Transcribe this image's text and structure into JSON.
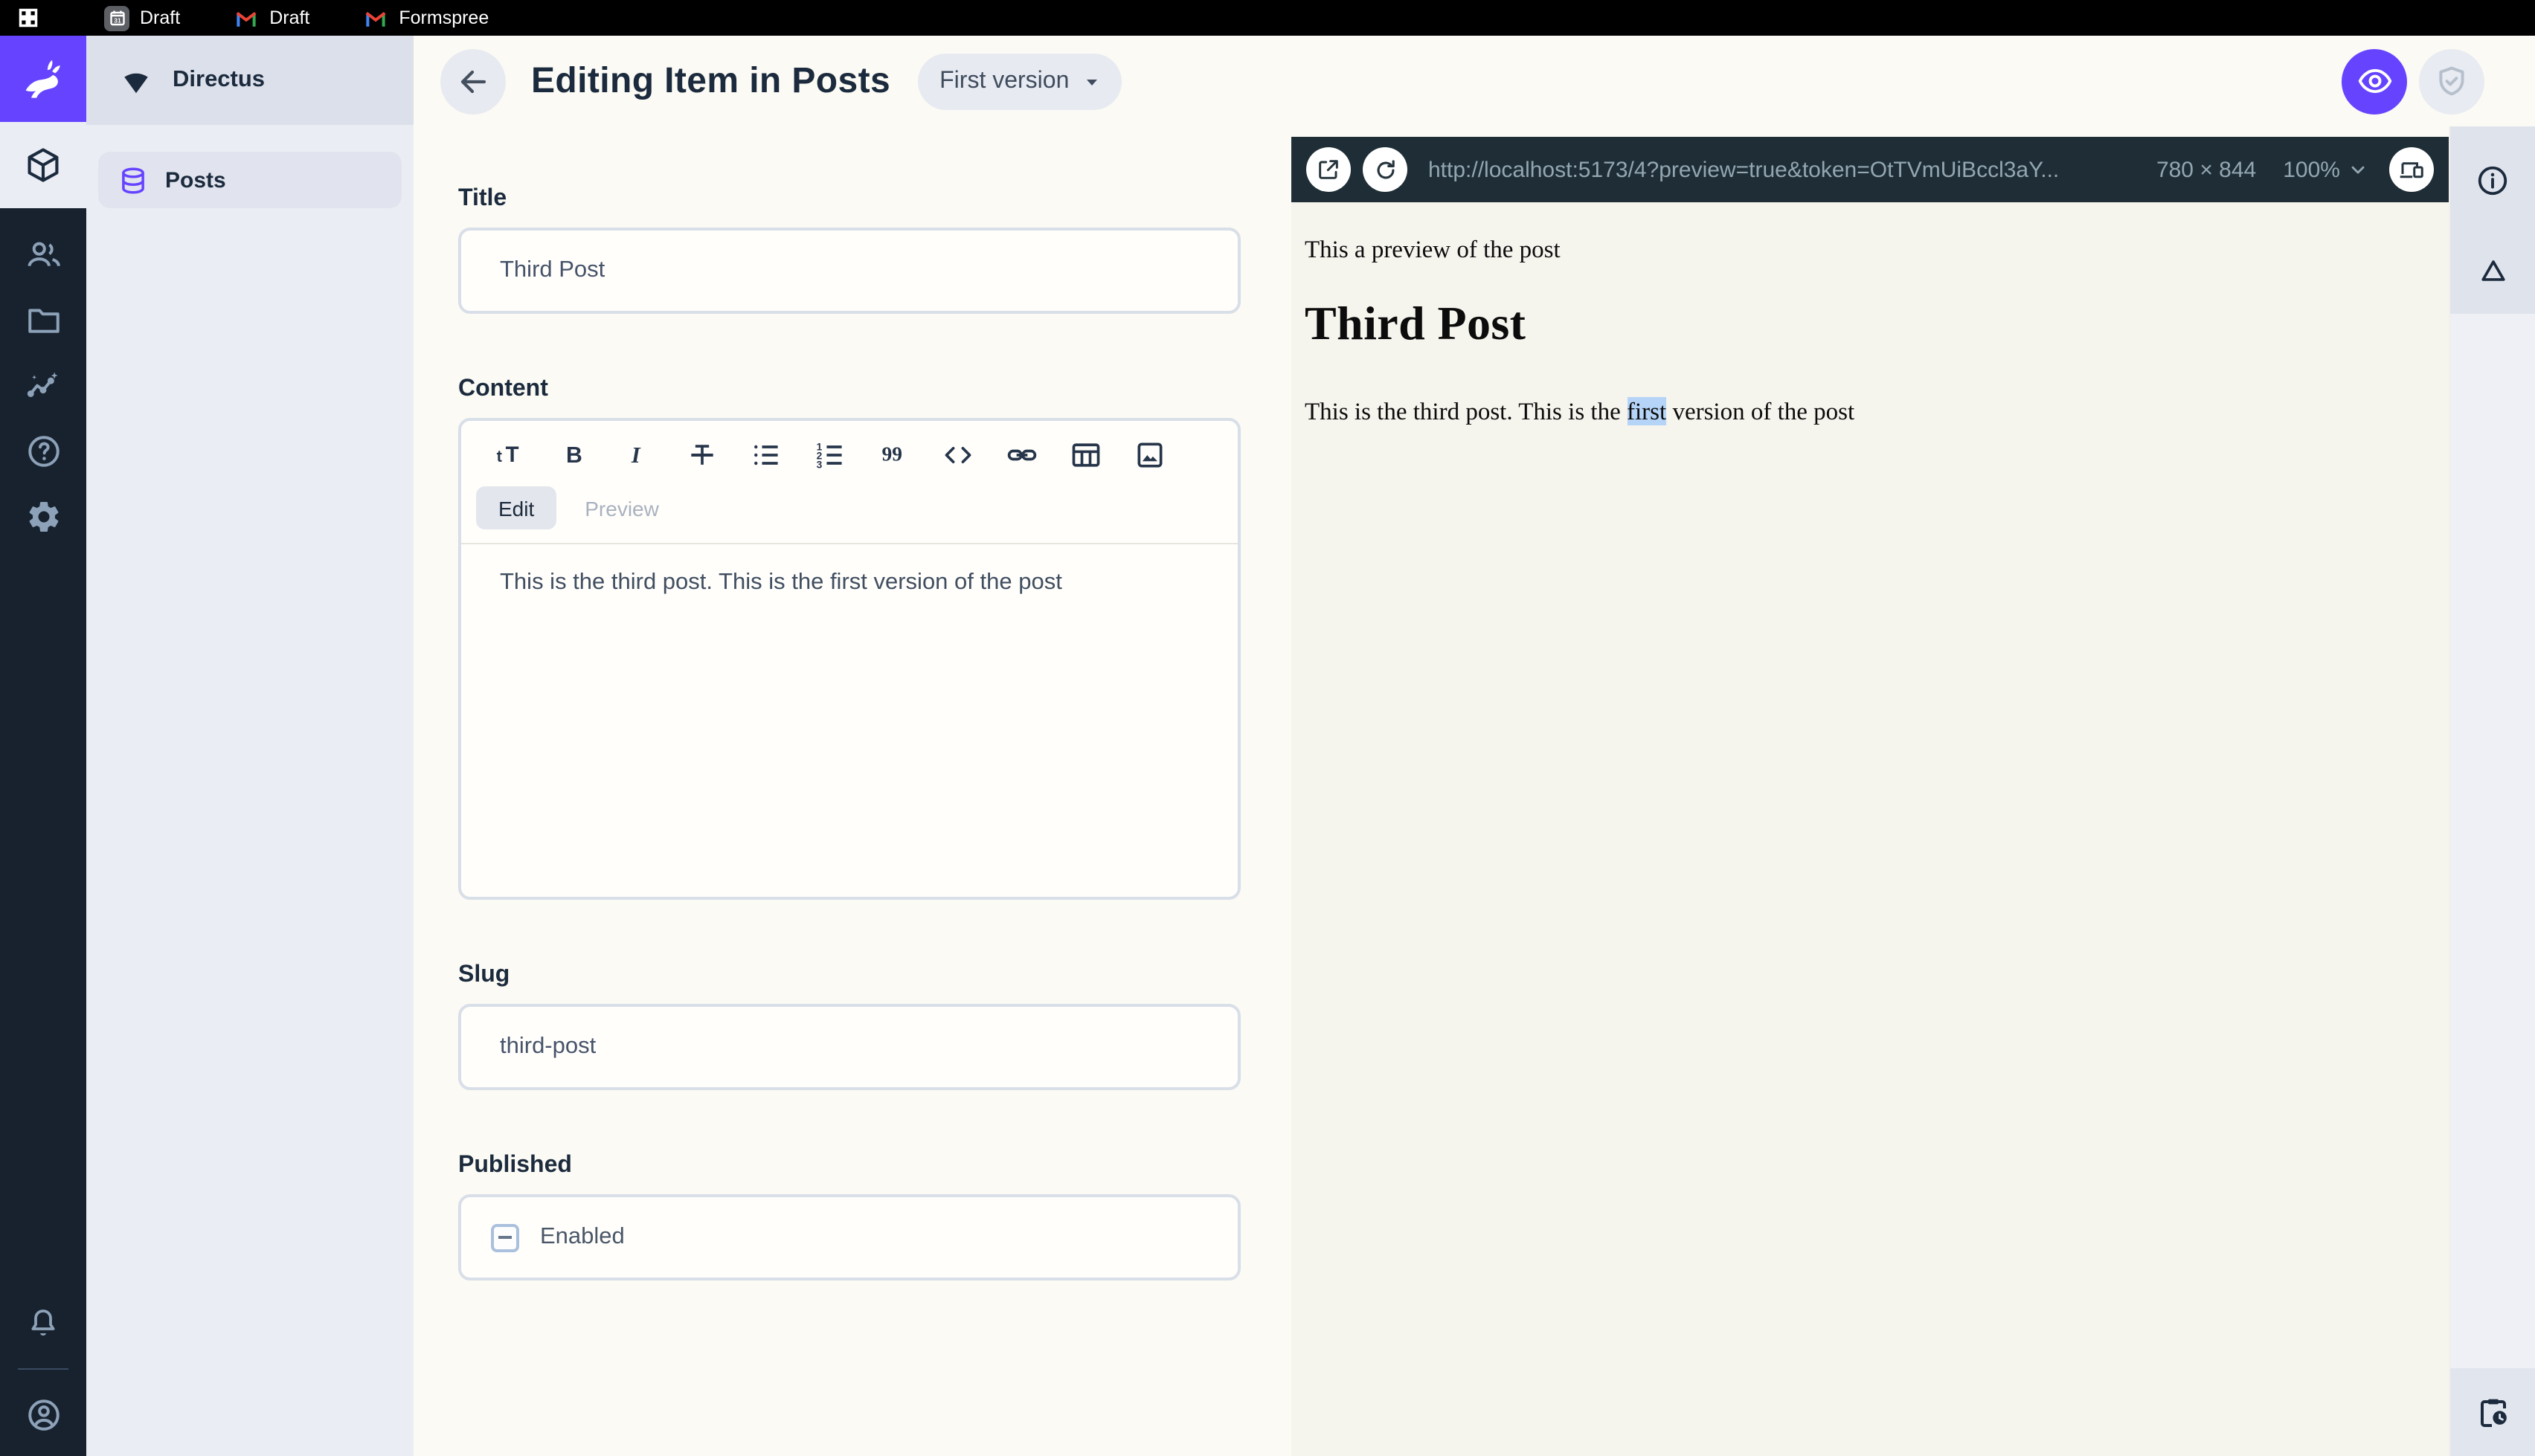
{
  "browser_tabs": {
    "tabs": [
      {
        "label": "Draft",
        "icon": "calendar-icon"
      },
      {
        "label": "Draft",
        "icon": "gmail-icon"
      },
      {
        "label": "Formspree",
        "icon": "gmail-icon"
      }
    ]
  },
  "sidebar": {
    "project_name": "Directus",
    "nav_items": [
      {
        "label": "Posts"
      }
    ]
  },
  "header": {
    "title": "Editing Item in Posts",
    "version_selector": "First version"
  },
  "form": {
    "title_field": {
      "label": "Title",
      "value": "Third Post"
    },
    "content_field": {
      "label": "Content",
      "edit_tab": "Edit",
      "preview_tab": "Preview",
      "value": "This is the third post. This is the first version of the post"
    },
    "slug_field": {
      "label": "Slug",
      "value": "third-post"
    },
    "published_field": {
      "label": "Published",
      "checkbox_label": "Enabled"
    }
  },
  "preview_panel": {
    "url": "http://localhost:5173/4?preview=true&token=OtTVmUiBccl3aY...",
    "viewport_size": "780 × 844",
    "zoom_level": "100%",
    "content": {
      "intro": "This a preview of the post",
      "heading": "Third Post",
      "paragraph_before": "This is the third post. This is the ",
      "paragraph_highlight": "first",
      "paragraph_after": " version of the post"
    }
  },
  "colors": {
    "accent": "#6644ff",
    "module_bar": "#18222f",
    "url_bar": "#1f2e36",
    "selection_highlight": "#b5d4f8"
  }
}
